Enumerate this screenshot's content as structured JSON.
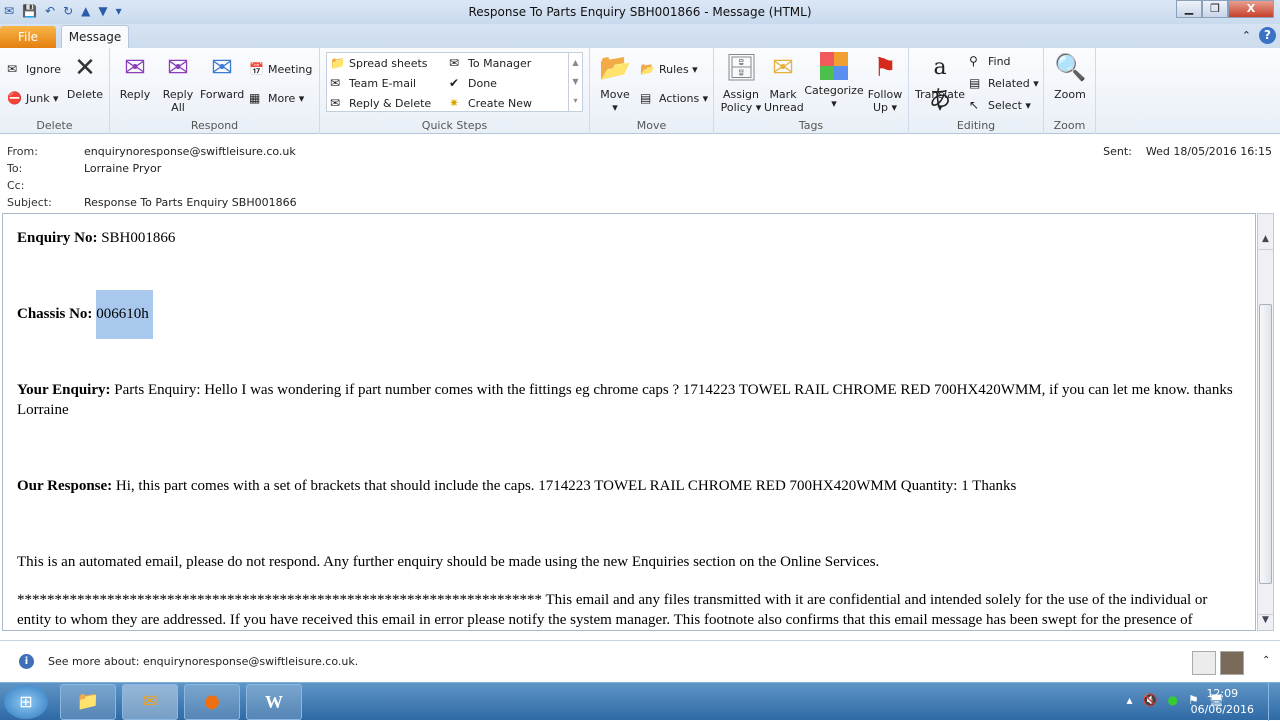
{
  "window": {
    "title": "Response To Parts Enquiry SBH001866  -  Message (HTML)"
  },
  "tabs": [
    {
      "label": "File"
    },
    {
      "label": "Message"
    }
  ],
  "ribbon": {
    "delete": {
      "label": "Delete",
      "ignore": "Ignore",
      "junk": "Junk",
      "delete": "Delete"
    },
    "respond": {
      "label": "Respond",
      "reply": "Reply",
      "reply_all_1": "Reply",
      "reply_all_2": "All",
      "forward": "Forward",
      "meeting": "Meeting",
      "more": "More"
    },
    "quick_steps": {
      "label": "Quick Steps",
      "items": [
        "Spread sheets",
        "To Manager",
        "Team E-mail",
        "Done",
        "Reply & Delete",
        "Create New"
      ]
    },
    "move": {
      "label": "Move",
      "move": "Move",
      "rules": "Rules",
      "actions": "Actions"
    },
    "tags": {
      "label": "Tags",
      "assign_1": "Assign",
      "assign_2": "Policy",
      "mark_1": "Mark",
      "mark_2": "Unread",
      "categorize": "Categorize",
      "follow_1": "Follow",
      "follow_2": "Up"
    },
    "editing": {
      "label": "Editing",
      "translate": "Translate",
      "find": "Find",
      "related": "Related",
      "select": "Select"
    },
    "zoom": {
      "label": "Zoom",
      "zoom": "Zoom"
    }
  },
  "header": {
    "from_label": "From:",
    "from": "enquirynoresponse@swiftleisure.co.uk",
    "to_label": "To:",
    "to": "Lorraine Pryor",
    "cc_label": "Cc:",
    "cc": "",
    "subject_label": "Subject:",
    "subject": "Response To Parts Enquiry SBH001866",
    "sent_label": "Sent:",
    "sent": "Wed 18/05/2016 16:15"
  },
  "body": {
    "enquiry_label": "Enquiry No:",
    "enquiry": " SBH001866",
    "chassis_label": "Chassis No:",
    "chassis": "006610h",
    "your_label": "Your Enquiry:",
    "your": " Parts Enquiry: Hello I was wondering if part number comes with the fittings eg chrome caps ? 1714223 TOWEL RAIL CHROME RED 700HX420WMM, if you can let me know. thanks Lorraine",
    "our_label": "Our Response:",
    "our": " Hi, this part comes with a set of brackets that should include the caps. 1714223 TOWEL RAIL CHROME RED 700HX420WMM Quantity: 1 Thanks",
    "automated": "This is an automated email, please do not respond. Any further enquiry should be made using the new Enquiries section on the Online Services.",
    "footer": "********************************************************************** This email and any files transmitted with it are confidential and intended solely for the use of the individual or entity to whom they are addressed. If you have received this email in error please notify the system manager. This footnote also confirms that this email message has been swept for the presence of computer viruses. ********************************************************************** Swift Group Limited Dunswell Road Cottingham East Yorkshire"
  },
  "people_pane": {
    "text": "See more about: enquirynoresponse@swiftleisure.co.uk."
  },
  "taskbar": {
    "time": "12:09",
    "date": "06/06/2016"
  }
}
